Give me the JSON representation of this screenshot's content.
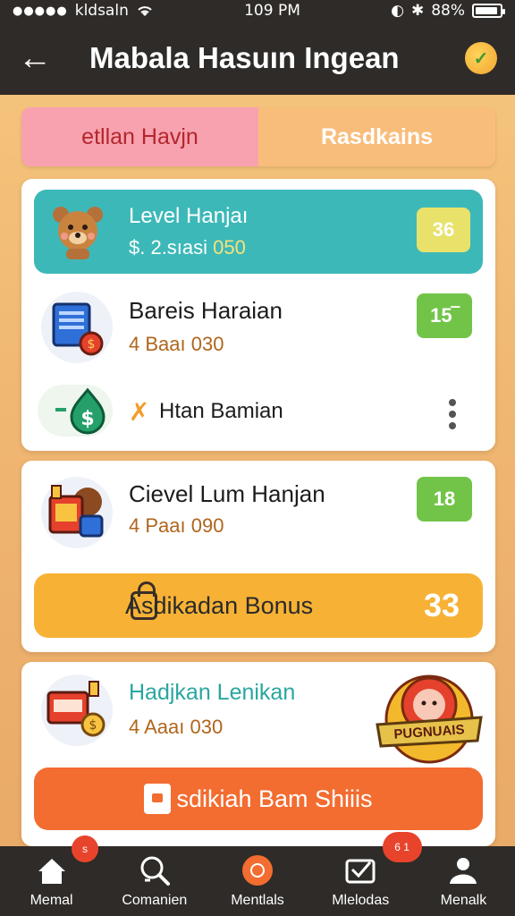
{
  "status": {
    "carrier": "kldsaln",
    "time": "109 PM",
    "battery": "88%"
  },
  "header": {
    "title": "Mabala Hasuın Ingean"
  },
  "tabs": [
    {
      "label": "etllan Havjn"
    },
    {
      "label": "Rasdkains"
    }
  ],
  "card1": {
    "level": {
      "title": "Level Hanjaı",
      "sub_prefix": "$. 2.sıasi ",
      "sub_highlight": "050",
      "badge": "36"
    },
    "daily": {
      "title": "Bareis Haraian",
      "sub": "4 Baaı 030",
      "badge": "15‾"
    },
    "hunt": {
      "title": "Htan Bamian"
    }
  },
  "card2": {
    "title": "Cievel Lum Hanjan",
    "sub": "4 Paaı 090",
    "badge": "18",
    "bonus_label": "Asdikadan Bonus",
    "bonus_value": "33"
  },
  "card3": {
    "title": "Hadjkan Lenikan",
    "sub": "4 Aaaı 030",
    "promo": "PUGNUAIS",
    "button": "sdikiah Bam Shiiis"
  },
  "nav": [
    {
      "label": "Memal",
      "icon": "home-icon"
    },
    {
      "label": "Comanien",
      "icon": "search-icon"
    },
    {
      "label": "Mentlals",
      "icon": "medal-icon"
    },
    {
      "label": "Mlelodas",
      "icon": "inbox-icon"
    },
    {
      "label": "Menalk",
      "icon": "profile-icon"
    }
  ],
  "colors": {
    "accent_teal": "#3db8b8",
    "accent_orange": "#f36c30",
    "accent_yellow": "#f7b235",
    "accent_green": "#72c449",
    "dark_bar": "#2f2b28"
  }
}
